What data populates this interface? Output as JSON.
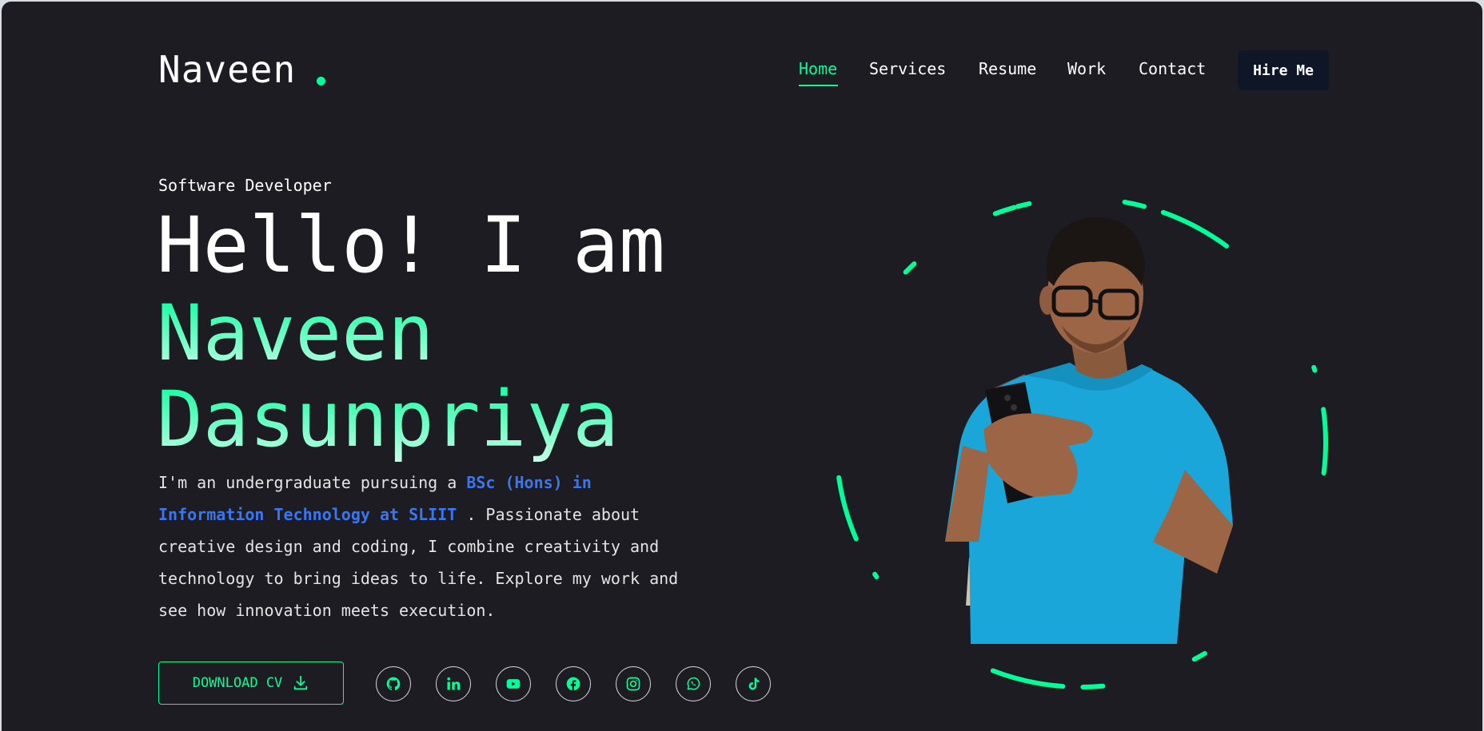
{
  "header": {
    "logo": "Naveen",
    "nav": [
      {
        "label": "Home",
        "active": true
      },
      {
        "label": "Services",
        "active": false
      },
      {
        "label": "Resume",
        "active": false
      },
      {
        "label": "Work",
        "active": false
      },
      {
        "label": "Contact",
        "active": false
      }
    ],
    "hire_label": "Hire Me"
  },
  "hero": {
    "role": "Software Developer",
    "greeting": "Hello! I am",
    "first_name": "Naveen",
    "last_name": "Dasunpriya",
    "bio_start": "I'm an undergraduate pursuing a ",
    "bio_highlight": "BSc (Hons) in Information Technology at SLIIT",
    "bio_end": " . Passionate about creative design and coding, I combine creativity and technology to bring ideas to life. Explore my work and see how innovation meets execution.",
    "cv_label": "Download CV"
  },
  "socials": [
    "github-icon",
    "linkedin-icon",
    "youtube-icon",
    "facebook-icon",
    "instagram-icon",
    "whatsapp-icon",
    "tiktok-icon"
  ],
  "colors": {
    "background": "#1d1c22",
    "accent": "#00ff99",
    "highlight": "#3a76f0",
    "hire_button": "#0e1628",
    "shirt": "#1aa6d8"
  }
}
